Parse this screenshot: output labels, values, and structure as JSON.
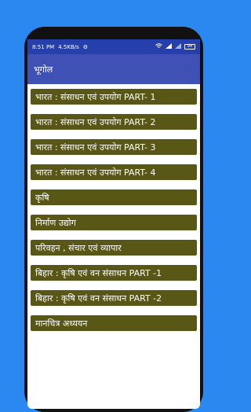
{
  "status_bar": {
    "time": "8:51 PM",
    "speed": "4.5KB/s",
    "battery": "94"
  },
  "app_bar": {
    "title": "भूगोल"
  },
  "list": {
    "items": [
      "भारत : संसाधन एवं उपयोग PART- 1",
      "भारत : संसाधन एवं उपयोग PART- 2",
      "भारत : संसाधन एवं उपयोग PART- 3",
      "भारत : संसाधन एवं उपयोग PART- 4",
      "कृषि",
      "निर्माण उद्योग",
      "परिवहन , संचार एवं व्यापार",
      "बिहार : कृषि एवं वन संसाधन PART -1",
      "बिहार : कृषि एवं वन संसाधन PART -2",
      "मानचित्र अध्ययन"
    ]
  },
  "colors": {
    "background": "#2a88f0",
    "status_bar": "#263fab",
    "app_bar": "#3f51b5",
    "list_item": "#595716"
  }
}
